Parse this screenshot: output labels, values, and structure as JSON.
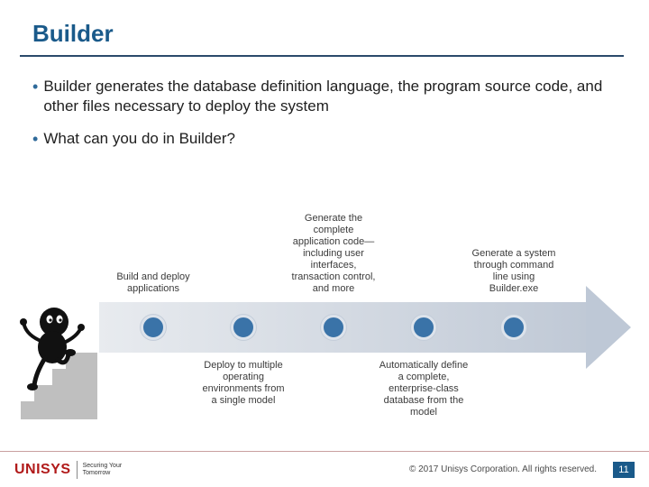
{
  "title": "Builder",
  "bullets": [
    "Builder generates the database definition language, the program source code, and other files necessary to deploy the system",
    "What can you do in Builder?"
  ],
  "steps": [
    {
      "pos": 60,
      "side": "top",
      "text": "Build and deploy applications"
    },
    {
      "pos": 160,
      "side": "bottom",
      "text": "Deploy to multiple operating environments from a single model"
    },
    {
      "pos": 260,
      "side": "top",
      "text": "Generate the complete application code—including user interfaces, transaction control, and more"
    },
    {
      "pos": 360,
      "side": "bottom",
      "text": "Automatically define a complete, enterprise-class database from the model"
    },
    {
      "pos": 460,
      "side": "top",
      "text": "Generate a system through command line using Builder.exe"
    }
  ],
  "logo": {
    "main": "UNISYS",
    "tagline1": "Securing Your",
    "tagline2": "Tomorrow"
  },
  "copyright": "© 2017 Unisys Corporation. All rights reserved.",
  "page": "11"
}
